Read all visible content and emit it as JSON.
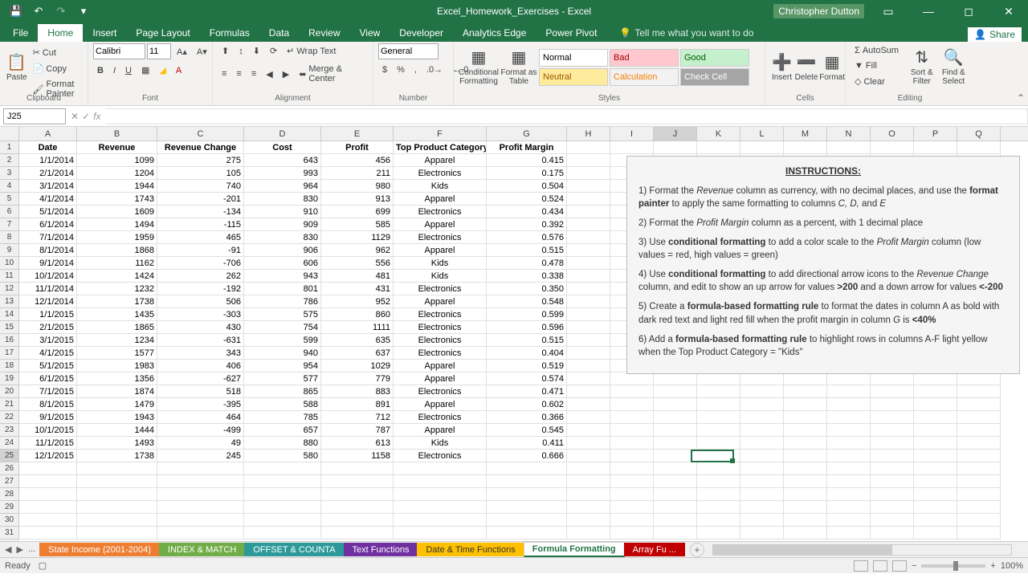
{
  "app": {
    "title": "Excel_Homework_Exercises - Excel",
    "user": "Christopher Dutton"
  },
  "tabs": {
    "file": "File",
    "home": "Home",
    "insert": "Insert",
    "pagelayout": "Page Layout",
    "formulas": "Formulas",
    "data": "Data",
    "review": "Review",
    "view": "View",
    "developer": "Developer",
    "analyticsedge": "Analytics Edge",
    "powerpivot": "Power Pivot",
    "tellme": "Tell me what you want to do",
    "share": "Share"
  },
  "ribbon": {
    "paste": "Paste",
    "cut": "Cut",
    "copy": "Copy",
    "formatpainter": "Format Painter",
    "clipboard": "Clipboard",
    "fontname": "Calibri",
    "fontsize": "11",
    "font": "Font",
    "wraptext": "Wrap Text",
    "mergecenter": "Merge & Center",
    "alignment": "Alignment",
    "numberformat": "General",
    "number": "Number",
    "conditional": "Conditional Formatting",
    "formatas": "Format as Table",
    "styles": "Styles",
    "style_normal": "Normal",
    "style_bad": "Bad",
    "style_good": "Good",
    "style_neutral": "Neutral",
    "style_calc": "Calculation",
    "style_check": "Check Cell",
    "insert_btn": "Insert",
    "delete_btn": "Delete",
    "format_btn": "Format",
    "cells": "Cells",
    "autosum": "AutoSum",
    "fill": "Fill",
    "clear": "Clear",
    "sortfilter": "Sort & Filter",
    "findselect": "Find & Select",
    "editing": "Editing"
  },
  "formulabar": {
    "namebox": "J25",
    "formula": ""
  },
  "columns": [
    "A",
    "B",
    "C",
    "D",
    "E",
    "F",
    "G",
    "H",
    "I",
    "J",
    "K",
    "L",
    "M",
    "N",
    "O",
    "P",
    "Q"
  ],
  "headers": {
    "date": "Date",
    "revenue": "Revenue",
    "revchange": "Revenue Change",
    "cost": "Cost",
    "profit": "Profit",
    "topcat": "Top Product Category",
    "margin": "Profit Margin"
  },
  "rows": [
    {
      "date": "1/1/2014",
      "rev": "1099",
      "chg": "275",
      "cost": "643",
      "profit": "456",
      "cat": "Apparel",
      "margin": "0.415"
    },
    {
      "date": "2/1/2014",
      "rev": "1204",
      "chg": "105",
      "cost": "993",
      "profit": "211",
      "cat": "Electronics",
      "margin": "0.175"
    },
    {
      "date": "3/1/2014",
      "rev": "1944",
      "chg": "740",
      "cost": "964",
      "profit": "980",
      "cat": "Kids",
      "margin": "0.504"
    },
    {
      "date": "4/1/2014",
      "rev": "1743",
      "chg": "-201",
      "cost": "830",
      "profit": "913",
      "cat": "Apparel",
      "margin": "0.524"
    },
    {
      "date": "5/1/2014",
      "rev": "1609",
      "chg": "-134",
      "cost": "910",
      "profit": "699",
      "cat": "Electronics",
      "margin": "0.434"
    },
    {
      "date": "6/1/2014",
      "rev": "1494",
      "chg": "-115",
      "cost": "909",
      "profit": "585",
      "cat": "Apparel",
      "margin": "0.392"
    },
    {
      "date": "7/1/2014",
      "rev": "1959",
      "chg": "465",
      "cost": "830",
      "profit": "1129",
      "cat": "Electronics",
      "margin": "0.576"
    },
    {
      "date": "8/1/2014",
      "rev": "1868",
      "chg": "-91",
      "cost": "906",
      "profit": "962",
      "cat": "Apparel",
      "margin": "0.515"
    },
    {
      "date": "9/1/2014",
      "rev": "1162",
      "chg": "-706",
      "cost": "606",
      "profit": "556",
      "cat": "Kids",
      "margin": "0.478"
    },
    {
      "date": "10/1/2014",
      "rev": "1424",
      "chg": "262",
      "cost": "943",
      "profit": "481",
      "cat": "Kids",
      "margin": "0.338"
    },
    {
      "date": "11/1/2014",
      "rev": "1232",
      "chg": "-192",
      "cost": "801",
      "profit": "431",
      "cat": "Electronics",
      "margin": "0.350"
    },
    {
      "date": "12/1/2014",
      "rev": "1738",
      "chg": "506",
      "cost": "786",
      "profit": "952",
      "cat": "Apparel",
      "margin": "0.548"
    },
    {
      "date": "1/1/2015",
      "rev": "1435",
      "chg": "-303",
      "cost": "575",
      "profit": "860",
      "cat": "Electronics",
      "margin": "0.599"
    },
    {
      "date": "2/1/2015",
      "rev": "1865",
      "chg": "430",
      "cost": "754",
      "profit": "1111",
      "cat": "Electronics",
      "margin": "0.596"
    },
    {
      "date": "3/1/2015",
      "rev": "1234",
      "chg": "-631",
      "cost": "599",
      "profit": "635",
      "cat": "Electronics",
      "margin": "0.515"
    },
    {
      "date": "4/1/2015",
      "rev": "1577",
      "chg": "343",
      "cost": "940",
      "profit": "637",
      "cat": "Electronics",
      "margin": "0.404"
    },
    {
      "date": "5/1/2015",
      "rev": "1983",
      "chg": "406",
      "cost": "954",
      "profit": "1029",
      "cat": "Apparel",
      "margin": "0.519"
    },
    {
      "date": "6/1/2015",
      "rev": "1356",
      "chg": "-627",
      "cost": "577",
      "profit": "779",
      "cat": "Apparel",
      "margin": "0.574"
    },
    {
      "date": "7/1/2015",
      "rev": "1874",
      "chg": "518",
      "cost": "865",
      "profit": "883",
      "cat": "Electronics",
      "margin": "0.471"
    },
    {
      "date": "8/1/2015",
      "rev": "1479",
      "chg": "-395",
      "cost": "588",
      "profit": "891",
      "cat": "Apparel",
      "margin": "0.602"
    },
    {
      "date": "9/1/2015",
      "rev": "1943",
      "chg": "464",
      "cost": "785",
      "profit": "712",
      "cat": "Electronics",
      "margin": "0.366"
    },
    {
      "date": "10/1/2015",
      "rev": "1444",
      "chg": "-499",
      "cost": "657",
      "profit": "787",
      "cat": "Apparel",
      "margin": "0.545"
    },
    {
      "date": "11/1/2015",
      "rev": "1493",
      "chg": "49",
      "cost": "880",
      "profit": "613",
      "cat": "Kids",
      "margin": "0.411"
    },
    {
      "date": "12/1/2015",
      "rev": "1738",
      "chg": "245",
      "cost": "580",
      "profit": "1158",
      "cat": "Electronics",
      "margin": "0.666"
    }
  ],
  "instructions": {
    "title": "INSTRUCTIONS:",
    "i1a": "1) Format the ",
    "i1b": "Revenue",
    "i1c": " column as currency, with no decimal places, and use the ",
    "i1d": "format painter",
    "i1e": " to apply the same formatting to columns ",
    "i1f": "C, D,",
    "i1g": " and ",
    "i1h": "E",
    "i2a": "2) Format the ",
    "i2b": "Profit Margin",
    "i2c": " column as a percent, with 1 decimal place",
    "i3a": "3) Use ",
    "i3b": "conditional formatting",
    "i3c": " to add a color scale to the ",
    "i3d": "Profit Margin",
    "i3e": " column (low values = red, high values = green)",
    "i4a": "4) Use ",
    "i4b": "conditional formatting",
    "i4c": " to add directional arrow icons to the ",
    "i4d": "Revenue Change",
    "i4e": " column, and edit to show an up arrow for values ",
    "i4f": ">200",
    "i4g": " and a down arrow for values ",
    "i4h": "<-200",
    "i5a": "5) Create a ",
    "i5b": "formula-based formatting rule",
    "i5c": " to format the dates in column A as bold with dark red text and light red fill when the profit margin in column ",
    "i5d": "G",
    "i5e": " is ",
    "i5f": "<40%",
    "i6a": "6) Add a ",
    "i6b": "formula-based formatting rule",
    "i6c": " to highlight rows in columns A-F light yellow when the Top Product Category = \"Kids\""
  },
  "sheets": {
    "ellipsis": "...",
    "s1": "State Income (2001-2004)",
    "s2": "INDEX & MATCH",
    "s3": "OFFSET & COUNTA",
    "s4": "Text Functions",
    "s5": "Date & Time Functions",
    "s6": "Formula Formatting",
    "s7": "Array Fu ..."
  },
  "status": {
    "ready": "Ready",
    "zoom": "100%"
  }
}
